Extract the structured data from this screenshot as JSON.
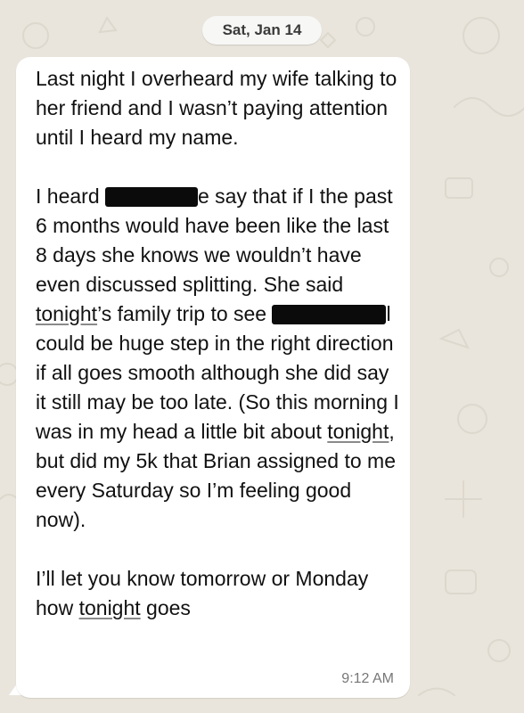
{
  "date_chip": "Sat, Jan 14",
  "message": {
    "p1": "Last night I overheard my wife talking to her friend and I wasn’t paying attention until I heard my name.",
    "p2_a": "I heard",
    "p2_b": "e say that if I the past 6 months would have been like the last 8 days she knows we wouldn’t have even discussed splitting. She said",
    "p2_tonight1": "tonight",
    "p2_c": "’s family trip to see",
    "p2_d": "l could be huge step in the right direction if all goes smooth although she did say it still may be too late. (So this morning I was in my head a little bit about",
    "p2_tonight2": "tonight",
    "p2_e": ", but did my 5k that Brian assigned to me every Saturday so I’m feeling good now).",
    "p3_a": "I’ll let you know tomorrow or Monday how",
    "p3_tonight": "tonight",
    "p3_b": "goes",
    "time": "9:12 AM"
  }
}
